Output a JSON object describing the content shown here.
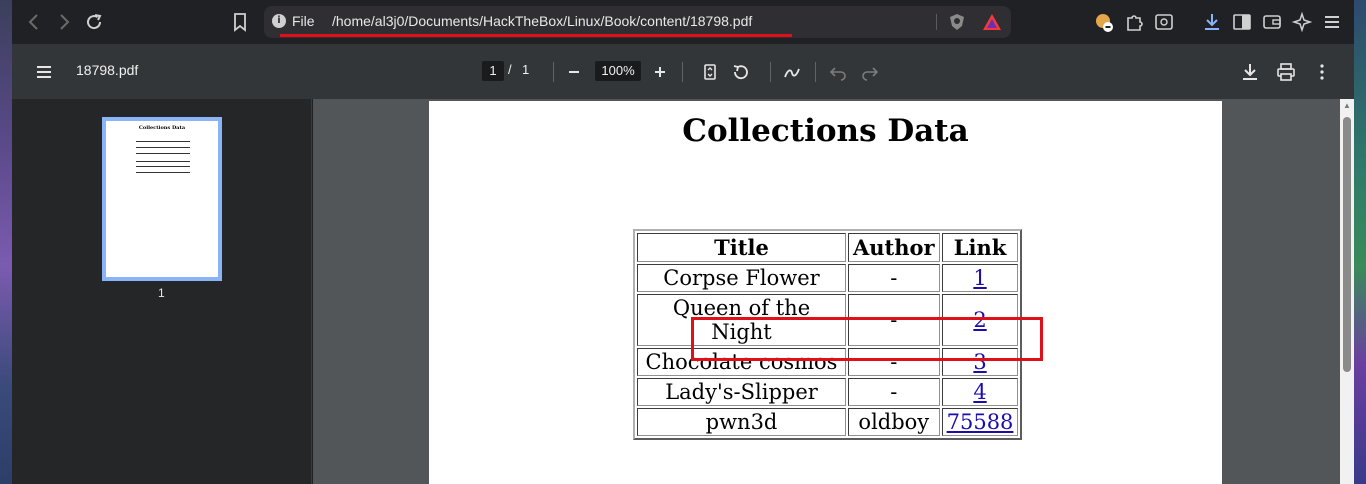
{
  "browser": {
    "url_scheme": "File",
    "url_path": "/home/al3j0/Documents/HackTheBox/Linux/Book/content/18798.pdf"
  },
  "pdf_toolbar": {
    "filename": "18798.pdf",
    "current_page": "1",
    "page_separator": "/",
    "total_pages": "1",
    "zoom": "100%"
  },
  "thumbnail": {
    "page_label": "1",
    "title": "Collections Data"
  },
  "document": {
    "title": "Collections Data",
    "table": {
      "headers": [
        "Title",
        "Author",
        "Link"
      ],
      "rows": [
        {
          "title": "Corpse Flower",
          "author": "-",
          "link": "1"
        },
        {
          "title": "Queen of the Night",
          "author": "-",
          "link": "2"
        },
        {
          "title": "Chocolate cosmos",
          "author": "-",
          "link": "3"
        },
        {
          "title": "Lady's-Slipper",
          "author": "-",
          "link": "4"
        },
        {
          "title": "pwn3d",
          "author": "oldboy",
          "link": "75588"
        }
      ]
    }
  },
  "colors": {
    "highlight": "#e0101a",
    "link": "#1a0dab",
    "thumbnail_border": "#8ab4f8"
  }
}
